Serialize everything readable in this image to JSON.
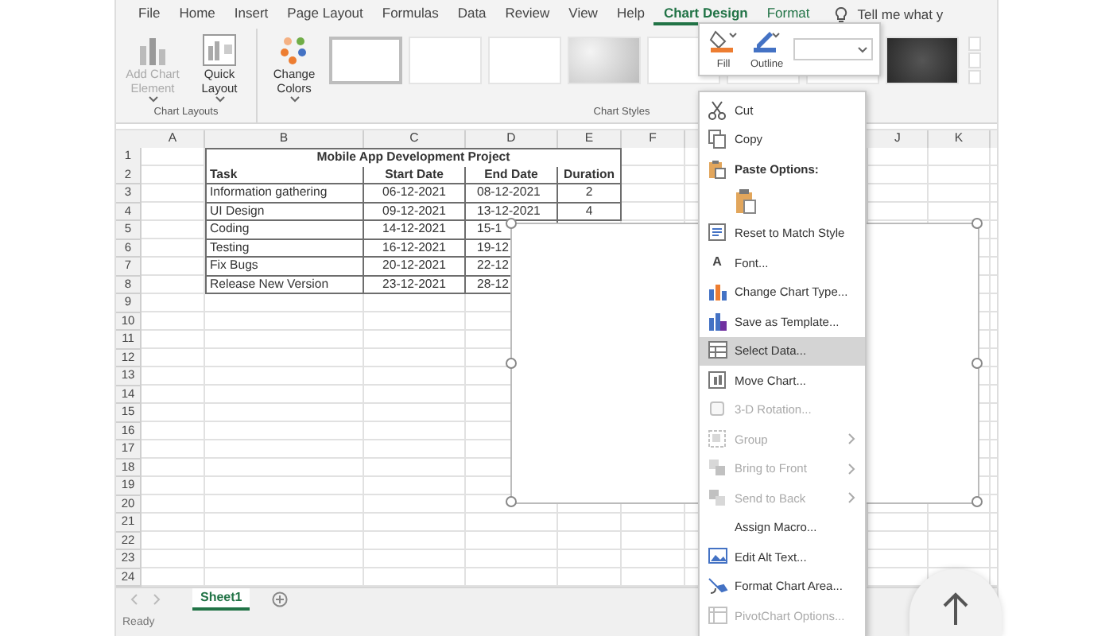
{
  "ribbon": {
    "tabs": [
      {
        "label": "File",
        "selected": false,
        "kind": "normal"
      },
      {
        "label": "Home",
        "selected": false,
        "kind": "normal"
      },
      {
        "label": "Insert",
        "selected": false,
        "kind": "normal"
      },
      {
        "label": "Page Layout",
        "selected": false,
        "kind": "normal"
      },
      {
        "label": "Formulas",
        "selected": false,
        "kind": "normal"
      },
      {
        "label": "Data",
        "selected": false,
        "kind": "normal"
      },
      {
        "label": "Review",
        "selected": false,
        "kind": "normal"
      },
      {
        "label": "View",
        "selected": false,
        "kind": "normal"
      },
      {
        "label": "Help",
        "selected": false,
        "kind": "normal"
      },
      {
        "label": "Chart Design",
        "selected": true,
        "kind": "contextual"
      },
      {
        "label": "Format",
        "selected": false,
        "kind": "contextual"
      }
    ],
    "tell_me": "Tell me what y",
    "buttons": [
      {
        "label": "Add Chart Element",
        "disabled": true
      },
      {
        "label": "Quick Layout",
        "disabled": false
      },
      {
        "label": "Change Colors",
        "disabled": false
      }
    ],
    "groups": [
      "Chart Layouts",
      "Chart Styles"
    ],
    "styles": [
      {
        "kind": "blank",
        "selected": true
      },
      {
        "kind": "blank",
        "selected": false
      },
      {
        "kind": "blank",
        "selected": false
      },
      {
        "kind": "gradient",
        "selected": false
      },
      {
        "kind": "blank",
        "selected": false
      },
      {
        "kind": "blank",
        "selected": false
      },
      {
        "kind": "blank",
        "selected": false
      },
      {
        "kind": "dark",
        "selected": false
      }
    ]
  },
  "mini_toolbar": {
    "buttons": [
      "Fill",
      "Outline"
    ]
  },
  "sheet": {
    "columns": [
      "A",
      "B",
      "C",
      "D",
      "E",
      "F",
      "J",
      "K"
    ],
    "row_numbers": [
      "1",
      "2",
      "3",
      "4",
      "5",
      "6",
      "7",
      "8",
      "9",
      "10",
      "11",
      "12",
      "13",
      "14",
      "15",
      "16",
      "17",
      "18",
      "19",
      "20",
      "21",
      "22",
      "23",
      "24"
    ],
    "title": "Mobile App Development Project",
    "header": [
      "Task",
      "Start Date",
      "End Date",
      "Duration"
    ],
    "records": [
      [
        "Information gathering",
        "06-12-2021",
        "08-12-2021",
        "2"
      ],
      [
        "UI Design",
        "09-12-2021",
        "13-12-2021",
        "4"
      ],
      [
        "Coding",
        "14-12-2021",
        "15-1"
      ],
      [
        "Testing",
        "16-12-2021",
        "19-12"
      ],
      [
        "Fix Bugs",
        "20-12-2021",
        "22-12"
      ],
      [
        "Release New Version",
        "23-12-2021",
        "28-12"
      ]
    ]
  },
  "context_menu": [
    {
      "label": "Cut",
      "kind": "item",
      "disabled": false,
      "selected": false,
      "submenu": false
    },
    {
      "label": "Copy",
      "kind": "item",
      "disabled": false,
      "selected": false,
      "submenu": false
    },
    {
      "label": "Paste Options:",
      "kind": "header"
    },
    {
      "kind": "paste"
    },
    {
      "label": "Reset to Match Style",
      "kind": "item",
      "disabled": false,
      "selected": false,
      "submenu": false
    },
    {
      "label": "Font...",
      "kind": "item",
      "disabled": false,
      "selected": false,
      "submenu": false,
      "glyph": "A"
    },
    {
      "label": "Change Chart Type...",
      "kind": "item",
      "disabled": false,
      "selected": false,
      "submenu": false
    },
    {
      "label": "Save as Template...",
      "kind": "item",
      "disabled": false,
      "selected": false,
      "submenu": false
    },
    {
      "label": "Select Data...",
      "kind": "item",
      "disabled": false,
      "selected": true,
      "submenu": false
    },
    {
      "label": "Move Chart...",
      "kind": "item",
      "disabled": false,
      "selected": false,
      "submenu": false
    },
    {
      "label": "3-D Rotation...",
      "kind": "item",
      "disabled": true,
      "selected": false,
      "submenu": false
    },
    {
      "label": "Group",
      "kind": "item",
      "disabled": true,
      "selected": false,
      "submenu": true
    },
    {
      "label": "Bring to Front",
      "kind": "item",
      "disabled": true,
      "selected": false,
      "submenu": true
    },
    {
      "label": "Send to Back",
      "kind": "item",
      "disabled": true,
      "selected": false,
      "submenu": true
    },
    {
      "label": "Assign Macro...",
      "kind": "item",
      "disabled": false,
      "selected": false,
      "submenu": false
    },
    {
      "label": "Edit Alt Text...",
      "kind": "item",
      "disabled": false,
      "selected": false,
      "submenu": false
    },
    {
      "label": "Format Chart Area...",
      "kind": "item",
      "disabled": false,
      "selected": false,
      "submenu": false
    },
    {
      "label": "PivotChart Options...",
      "kind": "item",
      "disabled": true,
      "selected": false,
      "submenu": false
    }
  ],
  "sheet_tabs": [
    {
      "label": "Sheet1",
      "selected": true
    }
  ],
  "status": "Ready"
}
